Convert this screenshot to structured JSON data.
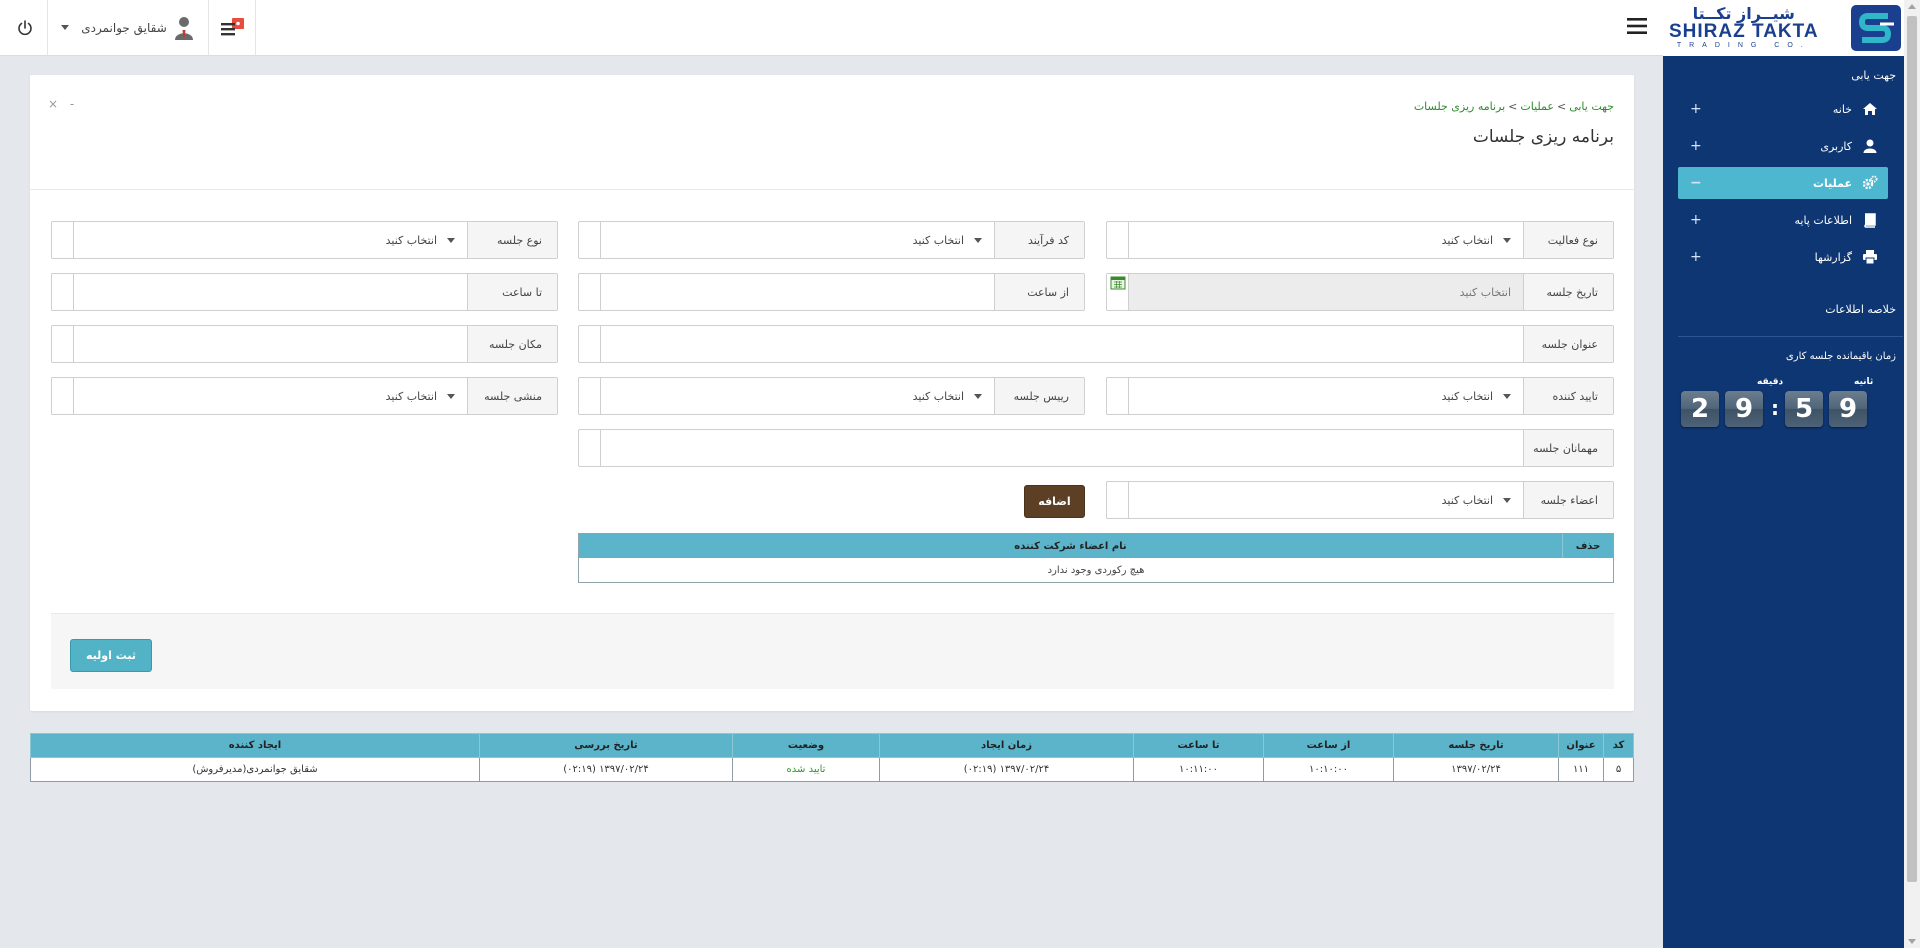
{
  "header": {
    "user_name": "شقایق جوانمردی"
  },
  "logo": {
    "fa": "شیــراز تکــتا",
    "en": "SHIRAZ TAKTA",
    "sub": "TRADING CO."
  },
  "sidebar": {
    "nav_title": "جهت یابی",
    "items": [
      {
        "label": "خانه",
        "icon": "home-icon",
        "toggle": "+"
      },
      {
        "label": "کاربری",
        "icon": "user-icon",
        "toggle": "+"
      },
      {
        "label": "عملیات",
        "icon": "gears-icon",
        "toggle": "−",
        "active": true
      },
      {
        "label": "اطلاعات پایه",
        "icon": "book-icon",
        "toggle": "+"
      },
      {
        "label": "گزارشها",
        "icon": "printer-icon",
        "toggle": "+"
      }
    ],
    "summary_title": "خلاصه اطلاعات",
    "session_title": "زمان باقیمانده جلسه کاری",
    "timer": {
      "minutes_label": "دقیقه",
      "seconds_label": "ثانیه",
      "m1": "2",
      "m2": "9",
      "s1": "5",
      "s2": "9"
    }
  },
  "panel": {
    "breadcrumb": [
      "جهت یابی",
      "عملیات",
      "برنامه ریزی جلسات"
    ],
    "title": "برنامه ریزی جلسات",
    "tools": {
      "close": "×",
      "minimize": "-"
    }
  },
  "form": {
    "activity_type": {
      "label": "نوع فعالیت",
      "value": "انتخاب کنید"
    },
    "process_code": {
      "label": "کد فرآیند",
      "value": "انتخاب کنید"
    },
    "meeting_type": {
      "label": "نوع جلسه",
      "value": "انتخاب کنید"
    },
    "meeting_date": {
      "label": "تاریخ جلسه",
      "placeholder": "انتخاب کنید"
    },
    "from_time": {
      "label": "از ساعت",
      "value": ""
    },
    "to_time": {
      "label": "تا ساعت",
      "value": ""
    },
    "meeting_title": {
      "label": "عنوان جلسه",
      "value": ""
    },
    "meeting_place": {
      "label": "مکان جلسه",
      "value": ""
    },
    "approver": {
      "label": "تایید کننده",
      "value": "انتخاب کنید"
    },
    "chairman": {
      "label": "رییس جلسه",
      "value": "انتخاب کنید"
    },
    "secretary": {
      "label": "منشی جلسه",
      "value": "انتخاب کنید"
    },
    "guests": {
      "label": "مهمانان جلسه",
      "value": ""
    },
    "members": {
      "label": "اعضاء جلسه",
      "value": "انتخاب کنید"
    },
    "add_button": "اضافه",
    "members_table": {
      "col_name": "نام اعضاء شرکت کننده",
      "col_delete": "حذف",
      "empty": "هیچ رکوردی وجود ندارد"
    },
    "submit_button": "ثبت اولیه"
  },
  "table": {
    "columns": [
      "کد",
      "عنوان",
      "تاریخ جلسه",
      "از ساعت",
      "تا ساعت",
      "زمان ایجاد",
      "وضعیت",
      "تاریخ بررسی",
      "ایجاد کننده"
    ],
    "rows": [
      [
        "۵",
        "۱۱۱",
        "۱۳۹۷/۰۲/۲۴",
        "۱۰:۱۰:۰۰",
        "۱۰:۱۱:۰۰",
        "۱۳۹۷/۰۲/۲۴ (۰۲:۱۹)",
        "تایید شده",
        "۱۳۹۷/۰۲/۲۴ (۰۲:۱۹)",
        "شقایق جوانمردی(مدیرفروش)"
      ]
    ]
  },
  "colors": {
    "sidebar_bg": "#0e3673",
    "accent": "#5bb4c9",
    "add_button": "#5c3f24",
    "breadcrumb": "#2d8a2d",
    "status_ok": "#2d9a2d"
  }
}
